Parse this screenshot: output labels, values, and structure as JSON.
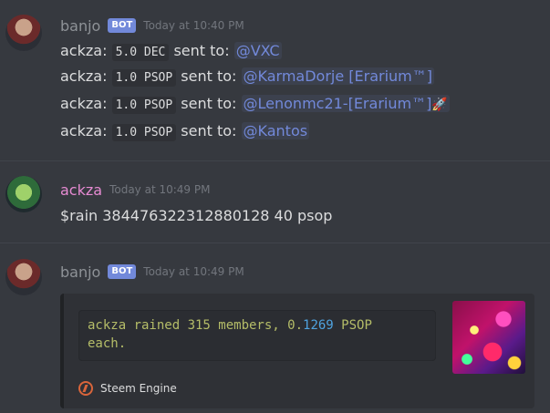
{
  "messages": [
    {
      "username": "banjo",
      "username_color": "#8e9297",
      "bot_tag": "BOT",
      "timestamp": "Today at 10:40 PM",
      "lines": [
        {
          "sender": "ackza:",
          "amount": "5.0",
          "token": "DEC",
          "text": "sent to:",
          "mention": "@VXC",
          "emoji": ""
        },
        {
          "sender": "ackza:",
          "amount": "1.0",
          "token": "PSOP",
          "text": "sent to:",
          "mention": "@KarmaDorje [Erarium™]",
          "emoji": ""
        },
        {
          "sender": "ackza:",
          "amount": "1.0",
          "token": "PSOP",
          "text": "sent to:",
          "mention": "@Lenonmc21-[Erarium™]",
          "emoji": "🚀"
        },
        {
          "sender": "ackza:",
          "amount": "1.0",
          "token": "PSOP",
          "text": "sent to:",
          "mention": "@Kantos",
          "emoji": ""
        }
      ]
    },
    {
      "username": "ackza",
      "username_color": "#e78bd3",
      "timestamp": "Today at 10:49 PM",
      "text": "$rain 384476322312880128 40 psop"
    },
    {
      "username": "banjo",
      "username_color": "#8e9297",
      "bot_tag": "BOT",
      "timestamp": "Today at 10:49 PM",
      "embed": {
        "desc_prefix": "ackza rained 315 members, 0.",
        "desc_number": "1269",
        "desc_suffix": " PSOP",
        "desc_line2": "each.",
        "footer_text": "Steem Engine",
        "footer_icon": "steem-engine-icon"
      }
    }
  ]
}
